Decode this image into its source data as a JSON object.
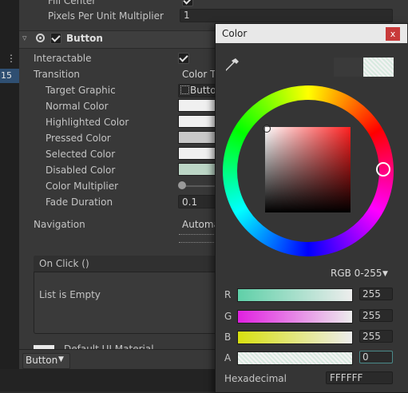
{
  "left_strip": {
    "number": "15"
  },
  "inspector": {
    "top_rows": [
      {
        "label": "Fill Center",
        "value": ""
      },
      {
        "label": "Pixels Per Unit Multiplier",
        "value": "1"
      }
    ],
    "component": {
      "name": "Button",
      "enabled": true
    },
    "rows": {
      "interactable": "Interactable",
      "transition": "Transition",
      "transition_value": "Color Ti",
      "target_graphic": "Target Graphic",
      "target_graphic_value": "Butto",
      "normal_color": "Normal Color",
      "highlighted_color": "Highlighted Color",
      "pressed_color": "Pressed Color",
      "selected_color": "Selected Color",
      "disabled_color": "Disabled Color",
      "color_multiplier": "Color Multiplier",
      "fade_duration": "Fade Duration",
      "fade_duration_value": "0.1",
      "navigation": "Navigation",
      "navigation_value": "Automa"
    },
    "onclick": {
      "header": "On Click ()",
      "empty": "List is Empty"
    },
    "material": "Default UI Material",
    "bottom_dropdown": "Button"
  },
  "color_window": {
    "title": "Color",
    "close": "x",
    "mode": "RGB 0-255",
    "channels": [
      {
        "label": "R",
        "value": "255"
      },
      {
        "label": "G",
        "value": "255"
      },
      {
        "label": "B",
        "value": "255"
      },
      {
        "label": "A",
        "value": "0"
      }
    ],
    "hex_label": "Hexadecimal",
    "hex_value": "FFFFFF"
  },
  "colors": {
    "accent": "#2f4f72",
    "close": "#c83a3a"
  }
}
